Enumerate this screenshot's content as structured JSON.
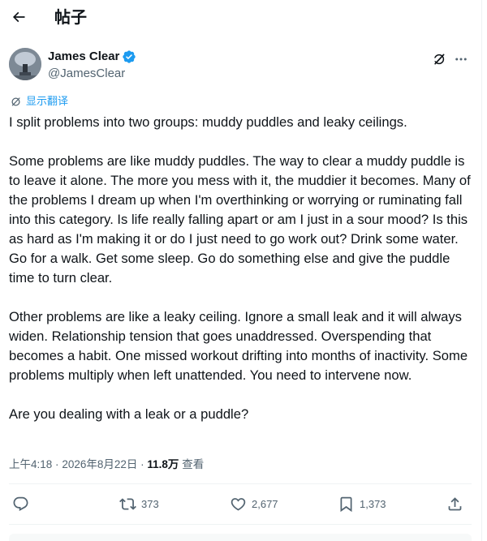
{
  "header": {
    "title": "帖子",
    "back_icon": "arrow-left-icon"
  },
  "author": {
    "name": "James Clear",
    "handle": "@JamesClear",
    "verified_color": "#1d9bf0"
  },
  "translate": {
    "label": "显示翻译"
  },
  "tweet": {
    "paragraphs": [
      "I split problems into two groups: muddy puddles and leaky ceilings.",
      "Some problems are like muddy puddles. The way to clear a muddy puddle is to leave it alone. The more you mess with it, the muddier it becomes. Many of the problems I dream up when I'm overthinking or worrying or ruminating fall into this category. Is life really falling apart or am I just in a sour mood? Is this as hard as I'm making it or do I just need to go work out? Drink some water. Go for a walk. Get some sleep. Go do something else and give the puddle time to turn clear.",
      "Other problems are like a leaky ceiling. Ignore a small leak and it will always widen. Relationship tension that goes unaddressed. Overspending that becomes a habit. One missed workout drifting into months of inactivity. Some problems multiply when left unattended. You need to intervene now.",
      "Are you dealing with a leak or a puddle?"
    ]
  },
  "meta": {
    "time": "上午4:18",
    "separator": "·",
    "date": "2026年8月22日",
    "views_count": "11.8万",
    "views_label": "查看"
  },
  "actions": {
    "reply_count": "",
    "retweet_count": "373",
    "like_count": "2,677",
    "bookmark_count": "1,373"
  },
  "colors": {
    "text": "#0f1419",
    "secondary": "#536471",
    "accent": "#1d9bf0",
    "divider": "#eff3f4"
  }
}
